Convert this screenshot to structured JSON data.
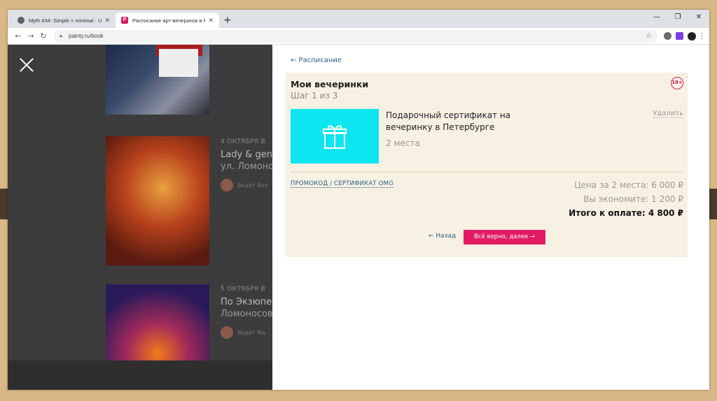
{
  "browser": {
    "tabs": [
      {
        "title": "Myth #34: Simple = minimal - U",
        "active": false
      },
      {
        "title": "Расписание арт-вечеринок в М",
        "active": true
      }
    ],
    "new_tab": "+",
    "window_controls": {
      "minimize": "—",
      "restore": "❐",
      "close": "✕"
    },
    "url": "painty.ru/book"
  },
  "background_list": [
    {
      "date": "",
      "title": "",
      "subtitle": "",
      "host": ""
    },
    {
      "date": "4 ОКТЯБРЯ В",
      "title": "Lady & gen",
      "subtitle": "ул. Ломонос",
      "host": "Ведёт Вол"
    },
    {
      "date": "5 ОКТЯБРЯ В",
      "title": "По Экзюпе",
      "subtitle": "Ломоносов",
      "host": "Ведёт Ма"
    }
  ],
  "panel": {
    "back_link": "← Расписание",
    "title": "Мои вечеринки",
    "step": "Шаг 1 из 3",
    "age_badge": "18+",
    "product": {
      "title": "Подарочный сертификат на вечеринку в Петербурге",
      "seats": "2 места",
      "remove": "Удалить"
    },
    "promo_link": "ПРОМОКОД / СЕРТИФИКАТ OMG",
    "price_line": "Цена за 2 места: 6 000 ₽",
    "savings_line": "Вы экономите: 1 200 ₽",
    "total_line": "Итого к оплате: 4 800 ₽",
    "back_button": "← Назад",
    "next_button": "Всё верно, далее →"
  },
  "colors": {
    "accent": "#e21b63",
    "link": "#2b5f8a",
    "gift_tile": "#0de6f0",
    "box_bg": "#f7f1e3"
  }
}
